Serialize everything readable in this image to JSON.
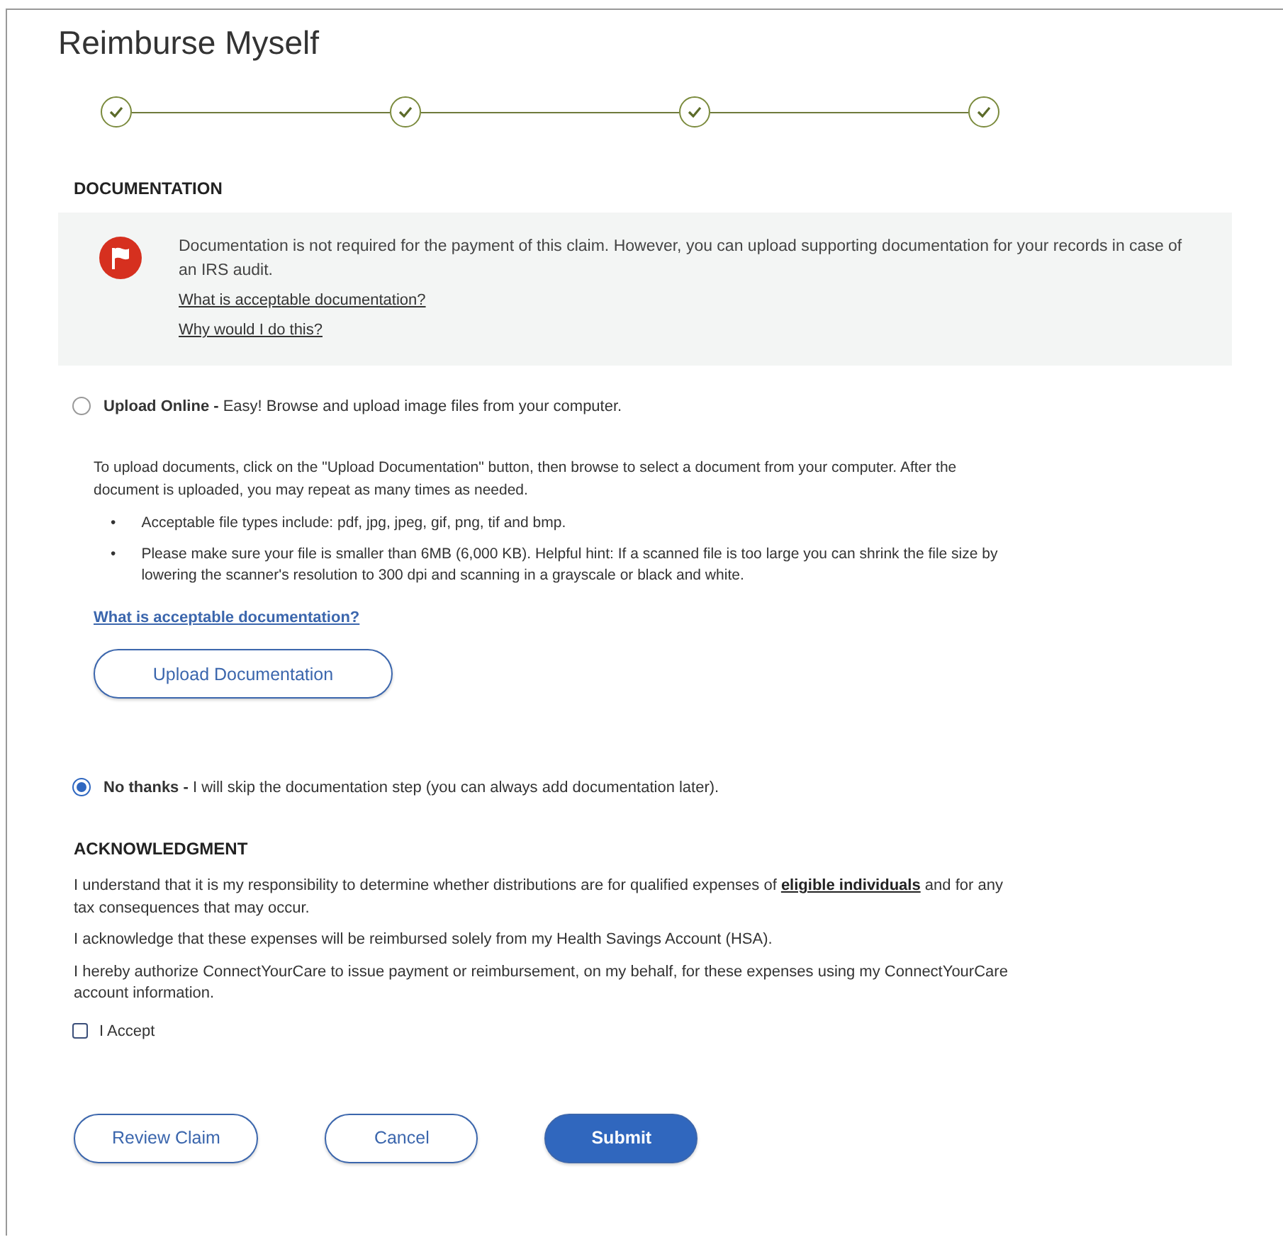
{
  "title": "Reimburse Myself",
  "steps": [
    {
      "completed": true
    },
    {
      "completed": true
    },
    {
      "completed": true
    },
    {
      "completed": true
    }
  ],
  "documentation": {
    "heading": "DOCUMENTATION",
    "notice": {
      "text": "Documentation is not required for the payment of this claim. However, you can upload supporting documentation for your records in case of an IRS audit.",
      "links": [
        "What is acceptable documentation?",
        "Why would I do this?"
      ]
    },
    "options": [
      {
        "kind": "upload",
        "label": "**Upload Online -** Easy! Browse and upload image files from your computer.",
        "selected": false,
        "instructions": "To upload documents, click on the \"Upload Documentation\" button, then browse to select a document from your computer. After the document is uploaded, you may repeat as many times as needed.",
        "bullets": [
          {
            "marker": "•",
            "text": "Acceptable file types include: pdf, jpg, jpeg, gif, png, tif and bmp."
          },
          {
            "marker": "•",
            "text": "Please make sure your file is smaller than 6MB (6,000 KB). Helpful hint: If a scanned file is too large you can shrink the file size by lowering the scanner's resolution to 300 dpi and scanning in a grayscale or black and white."
          }
        ],
        "link": "What is acceptable documentation?",
        "button": "Upload Documentation"
      },
      {
        "kind": "skip",
        "label": "**No thanks -** I will skip the documentation step (you can always add documentation later).",
        "selected": true
      }
    ]
  },
  "acknowledgment": {
    "heading": "ACKNOWLEDGMENT",
    "paragraphs": [
      {
        "before": "I understand that it is my responsibility to determine whether distributions are for qualified expenses of ",
        "link": "eligible individuals",
        "after": " and for any tax consequences that may occur."
      },
      {
        "before": "I acknowledge that these expenses will be reimbursed solely from my Health Savings Account (HSA)."
      },
      {
        "before": "I hereby authorize ConnectYourCare to issue payment or reimbursement, on my behalf, for these expenses using my ConnectYourCare account information."
      }
    ],
    "accept": {
      "label": "I Accept",
      "checked": false
    }
  },
  "buttons": [
    {
      "label": "Review Claim",
      "kind": "outline"
    },
    {
      "label": "Cancel",
      "kind": "outline"
    },
    {
      "label": "Submit",
      "kind": "primary"
    }
  ]
}
